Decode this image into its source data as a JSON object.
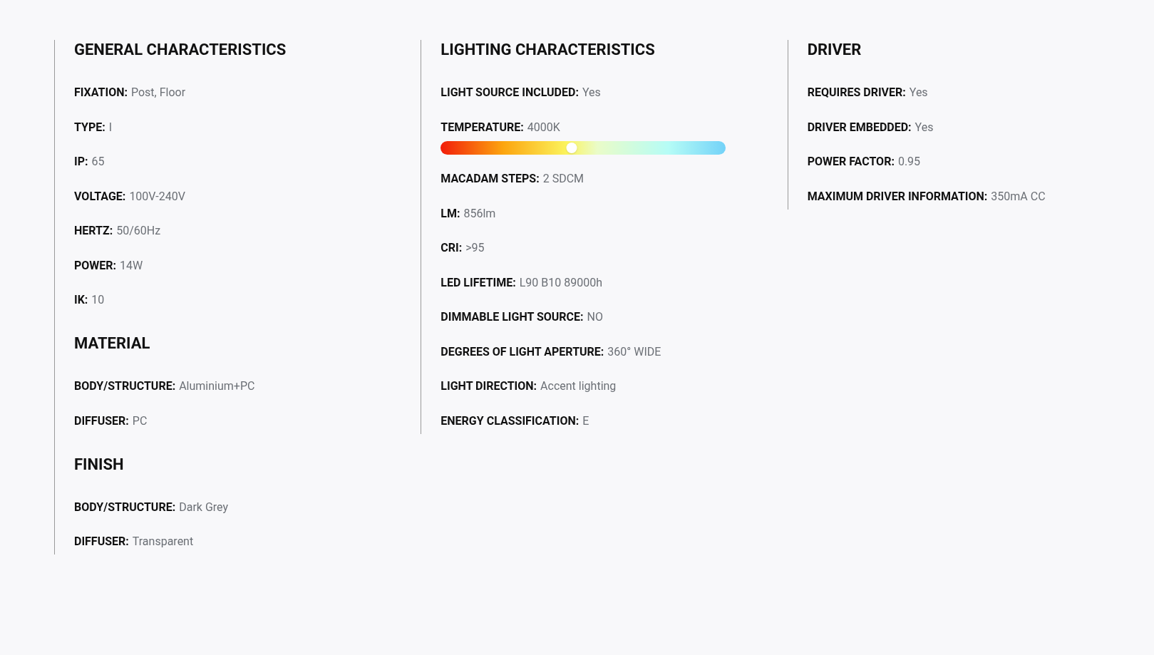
{
  "columns": [
    {
      "sections": [
        {
          "title": "GENERAL CHARACTERISTICS",
          "rows": [
            {
              "kind": "text",
              "label": "FIXATION:",
              "value": "Post, Floor"
            },
            {
              "kind": "text",
              "label": "TYPE:",
              "value": "I"
            },
            {
              "kind": "text",
              "label": "IP:",
              "value": "65"
            },
            {
              "kind": "text",
              "label": "VOLTAGE:",
              "value": "100V-240V"
            },
            {
              "kind": "text",
              "label": "HERTZ:",
              "value": "50/60Hz"
            },
            {
              "kind": "text",
              "label": "POWER:",
              "value": "14W"
            },
            {
              "kind": "text",
              "label": "IK:",
              "value": "10"
            }
          ]
        },
        {
          "title": "MATERIAL",
          "rows": [
            {
              "kind": "text",
              "label": "BODY/STRUCTURE:",
              "value": "Aluminium+PC"
            },
            {
              "kind": "text",
              "label": "DIFFUSER:",
              "value": "PC"
            }
          ]
        },
        {
          "title": "FINISH",
          "rows": [
            {
              "kind": "text",
              "label": "BODY/STRUCTURE:",
              "value": "Dark Grey"
            },
            {
              "kind": "text",
              "label": "DIFFUSER:",
              "value": "Transparent"
            }
          ]
        }
      ]
    },
    {
      "sections": [
        {
          "title": "LIGHTING CHARACTERISTICS",
          "rows": [
            {
              "kind": "text",
              "label": "LIGHT SOURCE INCLUDED:",
              "value": "Yes"
            },
            {
              "kind": "slider",
              "label": "TEMPERATURE:",
              "value": "4000K",
              "level": 0.46
            },
            {
              "kind": "text",
              "label": "MACADAM STEPS:",
              "value": "2 SDCM"
            },
            {
              "kind": "text",
              "label": "LM:",
              "value": "856lm"
            },
            {
              "kind": "text",
              "label": "CRI:",
              "value": ">95"
            },
            {
              "kind": "text",
              "label": "LED LIFETIME:",
              "value": "L90 B10 89000h"
            },
            {
              "kind": "text",
              "label": "DIMMABLE LIGHT SOURCE:",
              "value": "NO"
            },
            {
              "kind": "text",
              "label": "DEGREES OF LIGHT APERTURE:",
              "value": "360° WIDE"
            },
            {
              "kind": "text",
              "label": "LIGHT DIRECTION:",
              "value": "Accent lighting"
            },
            {
              "kind": "text",
              "label": "ENERGY CLASSIFICATION:",
              "value": "E"
            }
          ]
        }
      ]
    },
    {
      "sections": [
        {
          "title": "DRIVER",
          "rows": [
            {
              "kind": "text",
              "label": "REQUIRES DRIVER:",
              "value": "Yes"
            },
            {
              "kind": "text",
              "label": "DRIVER EMBEDDED:",
              "value": "Yes"
            },
            {
              "kind": "text",
              "label": "POWER FACTOR:",
              "value": "0.95"
            },
            {
              "kind": "text",
              "label": "MAXIMUM DRIVER INFORMATION:",
              "value": "350mA CC"
            }
          ]
        }
      ]
    }
  ]
}
